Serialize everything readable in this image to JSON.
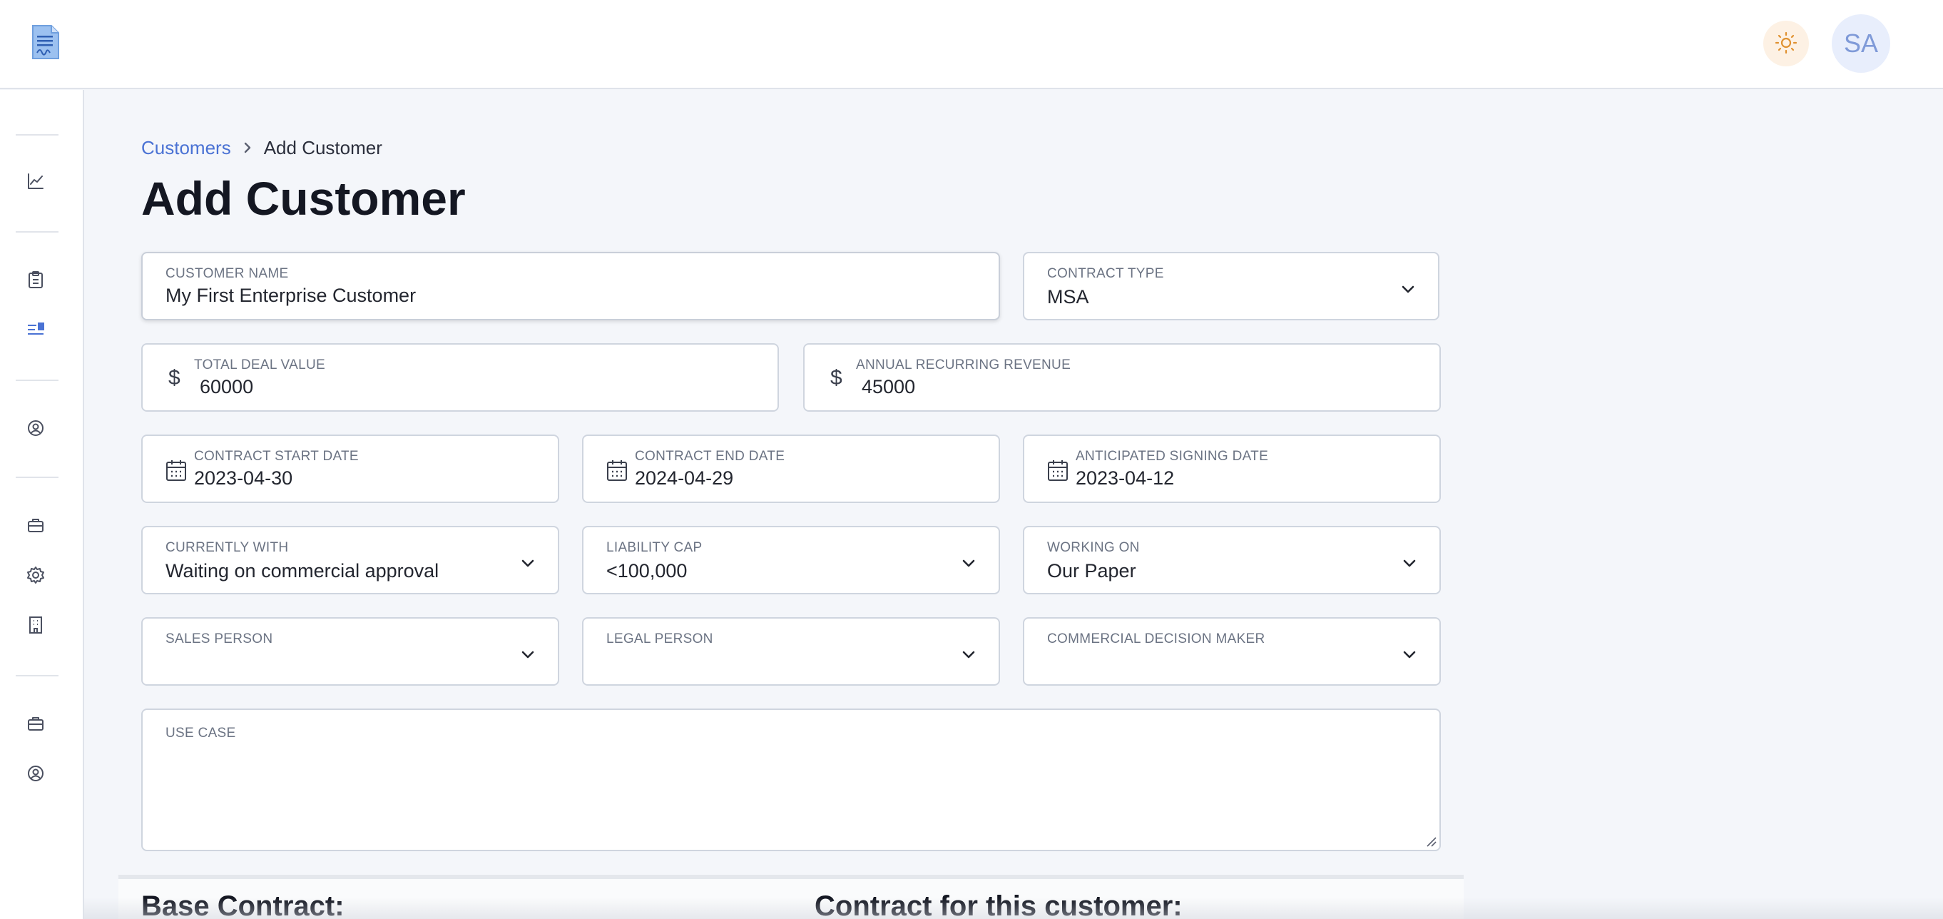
{
  "header": {
    "avatar_initials": "SA"
  },
  "icons": {
    "logo": "document-signature-icon",
    "theme": "sun-icon",
    "sidebar": [
      "chart-line-icon",
      "clipboard-icon",
      "list-checks-icon",
      "user-circle-icon",
      "briefcase-icon",
      "gear-icon",
      "building-icon",
      "briefcase-icon",
      "user-circle-icon"
    ]
  },
  "colors": {
    "accent": "#4a72d4",
    "theme_button_bg": "#fdf1e4",
    "sun": "#e0912f",
    "avatar_bg": "#e8eefc"
  },
  "breadcrumb": {
    "parent": "Customers",
    "current": "Add Customer"
  },
  "page": {
    "title": "Add Customer"
  },
  "form": {
    "customer_name": {
      "label": "CUSTOMER NAME",
      "value": "My First Enterprise Customer"
    },
    "contract_type": {
      "label": "CONTRACT TYPE",
      "value": "MSA"
    },
    "total_deal_value": {
      "label": "TOTAL DEAL VALUE",
      "prefix": "$",
      "value": "60000"
    },
    "annual_recurring_revenue": {
      "label": "ANNUAL RECURRING REVENUE",
      "prefix": "$",
      "value": "45000"
    },
    "contract_start_date": {
      "label": "CONTRACT START DATE",
      "value": "2023-04-30"
    },
    "contract_end_date": {
      "label": "CONTRACT END DATE",
      "value": "2024-04-29"
    },
    "anticipated_signing_date": {
      "label": "ANTICIPATED SIGNING DATE",
      "value": "2023-04-12"
    },
    "currently_with": {
      "label": "CURRENTLY WITH",
      "value": "Waiting on commercial approval"
    },
    "liability_cap": {
      "label": "LIABILITY CAP",
      "value": "<100,000"
    },
    "working_on": {
      "label": "WORKING ON",
      "value": "Our Paper"
    },
    "sales_person": {
      "label": "SALES PERSON",
      "value": ""
    },
    "legal_person": {
      "label": "LEGAL PERSON",
      "value": ""
    },
    "commercial_decision_maker": {
      "label": "COMMERCIAL DECISION MAKER",
      "value": ""
    },
    "use_case": {
      "label": "USE CASE",
      "value": ""
    }
  },
  "sections": {
    "base_contract": "Base Contract:",
    "customer_contract": "Contract for this customer:"
  }
}
